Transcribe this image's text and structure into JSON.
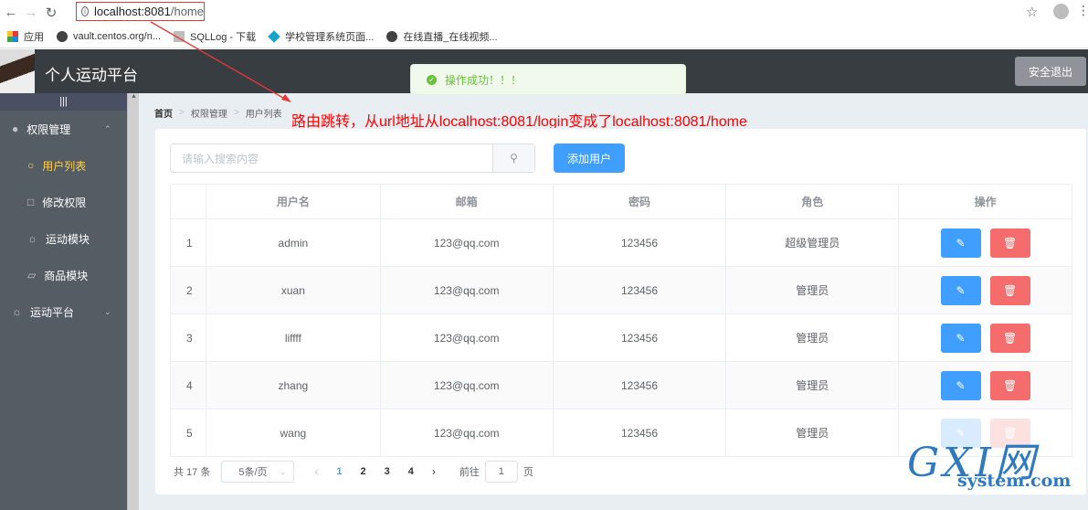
{
  "browser": {
    "url_host": "localhost:8081",
    "url_path": "/home",
    "bookmarks": [
      "应用",
      "vault.centos.org/n...",
      "SQLLog - 下载",
      "学校管理系统页面...",
      "在线直播_在线视频..."
    ]
  },
  "header": {
    "title": "个人运动平台",
    "logout_label": "安全退出"
  },
  "toast": {
    "message": "操作成功！！！"
  },
  "sidebar": {
    "toggle": "|||",
    "items": [
      {
        "label": "权限管理",
        "icon": "user-icon",
        "type": "group"
      },
      {
        "label": "用户列表",
        "icon": "user-icon",
        "type": "sub",
        "active": true
      },
      {
        "label": "修改权限",
        "icon": "lock-icon",
        "type": "sub"
      },
      {
        "label": "运动模块",
        "icon": "sun-icon",
        "type": "sub"
      },
      {
        "label": "商品模块",
        "icon": "bag-icon",
        "type": "sub"
      },
      {
        "label": "运动平台",
        "icon": "sun-icon",
        "type": "group"
      }
    ]
  },
  "breadcrumb": [
    "首页",
    "权限管理",
    "用户列表"
  ],
  "annotation": "路由跳转，从url地址从localhost:8081/login变成了localhost:8081/home",
  "search": {
    "placeholder": "请输入搜索内容"
  },
  "add_button": "添加用户",
  "table": {
    "columns": [
      "",
      "用户名",
      "邮箱",
      "密码",
      "角色",
      "操作"
    ],
    "rows": [
      {
        "index": "1",
        "username": "admin",
        "email": "123@qq.com",
        "password": "123456",
        "role": "超级管理员"
      },
      {
        "index": "2",
        "username": "xuan",
        "email": "123@qq.com",
        "password": "123456",
        "role": "管理员"
      },
      {
        "index": "3",
        "username": "liffff",
        "email": "123@qq.com",
        "password": "123456",
        "role": "管理员"
      },
      {
        "index": "4",
        "username": "zhang",
        "email": "123@qq.com",
        "password": "123456",
        "role": "管理员"
      },
      {
        "index": "5",
        "username": "wang",
        "email": "123@qq.com",
        "password": "123456",
        "role": "管理员"
      }
    ]
  },
  "pagination": {
    "total": "共 17 条",
    "page_size": "5条/页",
    "pages": [
      "1",
      "2",
      "3",
      "4"
    ],
    "current": "1",
    "goto_prefix": "前往",
    "goto_value": "1",
    "goto_suffix": "页"
  },
  "watermark": {
    "big": "GXI网",
    "small": "system.com"
  }
}
